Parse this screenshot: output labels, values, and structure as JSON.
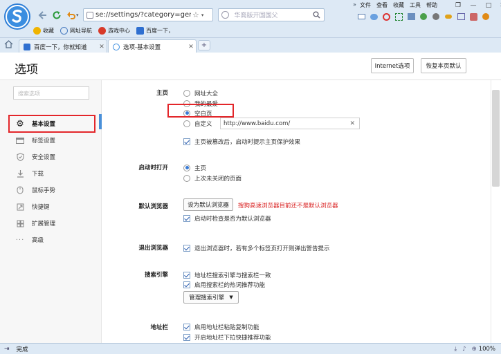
{
  "browser": {
    "address": "se://settings/?category=gener",
    "search_placeholder": "华裔版开国国父",
    "menus": [
      "文件",
      "查看",
      "收藏",
      "工具",
      "帮助"
    ],
    "bookmarks": [
      "收藏",
      "网址导航",
      "游戏中心",
      "百度一下，"
    ],
    "tabs": [
      {
        "label": "百度一下，你就知道",
        "active": false
      },
      {
        "label": "选项-基本设置",
        "active": true
      }
    ],
    "new_tab": "+"
  },
  "page": {
    "title": "选项",
    "internet_options": "Internet选项",
    "restore_defaults": "恢复本页默认"
  },
  "sidebar": {
    "search_placeholder": "搜索选项",
    "items": [
      {
        "label": "基本设置",
        "icon": "gear-icon",
        "active": true
      },
      {
        "label": "标签设置",
        "icon": "tab-icon"
      },
      {
        "label": "安全设置",
        "icon": "shield-check-icon"
      },
      {
        "label": "下载",
        "icon": "download-icon"
      },
      {
        "label": "鼠标手势",
        "icon": "mouse-gesture-icon"
      },
      {
        "label": "快捷键",
        "icon": "shortcut-icon"
      },
      {
        "label": "扩展管理",
        "icon": "extensions-icon"
      },
      {
        "label": "高级",
        "icon": "more-icon"
      }
    ]
  },
  "settings": {
    "homepage": {
      "label": "主页",
      "options": [
        "网址大全",
        "我的最爱",
        "空白页",
        "自定义"
      ],
      "selected": "空白页",
      "custom_url": "http://www.baidu.com/",
      "protect_label": "主页被篡改后，启动时提示主页保护效果",
      "protect_checked": true
    },
    "startup": {
      "label": "启动时打开",
      "options": [
        "主页",
        "上次未关闭的页面"
      ],
      "selected": "主页"
    },
    "default_browser": {
      "label": "默认浏览器",
      "button": "设为默认浏览器",
      "warning": "搜狗高速浏览器目前还不是默认浏览器",
      "check_label": "启动时检查是否为默认浏览器",
      "checked": true
    },
    "exit": {
      "label": "退出浏览器",
      "check_label": "退出浏览器时，若有多个标签页打开则弹出警告提示",
      "checked": true
    },
    "search_engine": {
      "label": "搜索引擎",
      "check1": "地址栏搜索引擎与搜索栏一致",
      "check2": "启用搜索栏的热词推荐功能",
      "manage": "管理搜索引擎"
    },
    "address_bar": {
      "label": "地址栏",
      "check1": "启用地址栏粘贴复制功能",
      "check2": "开启地址栏下拉快捷推荐功能"
    }
  },
  "status": {
    "text": "完成",
    "zoom": "100%"
  },
  "colors": {
    "chrome": "#dde9f5",
    "highlight": "#e3262a",
    "accent": "#4a90d9",
    "warning": "#d92020"
  }
}
